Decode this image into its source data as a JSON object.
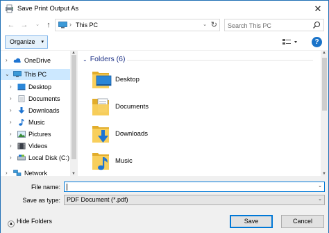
{
  "window": {
    "title": "Save Print Output As",
    "close_glyph": "✕",
    "accent": "#1f6fb5"
  },
  "address_bar": {
    "back_glyph": "←",
    "forward_glyph": "→",
    "recent_glyph": "⌄",
    "up_glyph": "↑",
    "separator": "›",
    "location": "This PC",
    "dropdown_glyph": "⌄",
    "refresh_glyph": "↻"
  },
  "search": {
    "placeholder": "Search This PC"
  },
  "toolbar": {
    "organize_label": "Organize",
    "organize_arrow": "▾",
    "help_label": "?"
  },
  "nav_pane": {
    "items": [
      {
        "label": "OneDrive",
        "icon": "cloud-icon",
        "expanded": false
      },
      {
        "label": "This PC",
        "icon": "computer-icon",
        "expanded": true,
        "selected": true
      },
      {
        "label": "Desktop",
        "icon": "desktop-folder-icon"
      },
      {
        "label": "Documents",
        "icon": "documents-folder-icon"
      },
      {
        "label": "Downloads",
        "icon": "downloads-folder-icon"
      },
      {
        "label": "Music",
        "icon": "music-folder-icon"
      },
      {
        "label": "Pictures",
        "icon": "pictures-folder-icon"
      },
      {
        "label": "Videos",
        "icon": "videos-folder-icon"
      },
      {
        "label": "Local Disk (C:)",
        "icon": "drive-icon"
      },
      {
        "label": "Network",
        "icon": "network-icon"
      }
    ],
    "chevron_right": "›",
    "chevron_down": "⌄"
  },
  "content": {
    "group_header": "Folders (6)",
    "group_chevron": "⌄",
    "folders": [
      {
        "label": "Desktop",
        "icon": "desktop-folder-icon"
      },
      {
        "label": "Documents",
        "icon": "documents-folder-icon"
      },
      {
        "label": "Downloads",
        "icon": "downloads-folder-icon"
      },
      {
        "label": "Music",
        "icon": "music-folder-icon"
      }
    ]
  },
  "form": {
    "filename_label": "File name:",
    "filename_value": "",
    "savetype_label": "Save as type:",
    "savetype_value": "PDF Document (*.pdf)",
    "dropdown_glyph": "⌄"
  },
  "footer": {
    "hide_folders_label": "Hide Folders",
    "hide_folders_arrow": "▲",
    "save_label": "Save",
    "cancel_label": "Cancel"
  },
  "colors": {
    "folder_yellow": "#f8cf5c",
    "folder_dark": "#e2ad2b",
    "selection_blue": "#cce8ff",
    "primary_blue": "#0078d7",
    "group_header": "#1e3287"
  }
}
